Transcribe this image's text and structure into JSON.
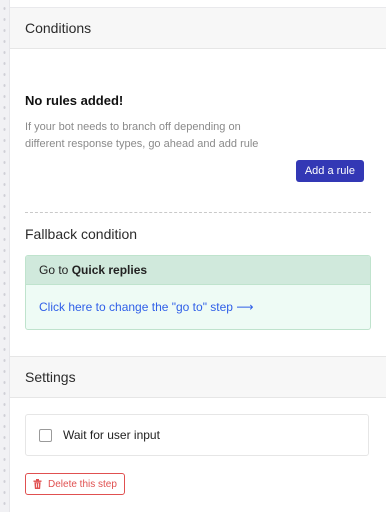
{
  "conditions": {
    "title": "Conditions",
    "empty_title": "No rules added!",
    "empty_description": "If your bot needs to branch off depending on different response types, go ahead and add rule",
    "add_rule_label": "Add a rule"
  },
  "fallback": {
    "title": "Fallback condition",
    "goto_prefix": "Go to",
    "goto_target": "Quick replies",
    "change_link": "Click here to change the \"go to\" step",
    "arrow_glyph": "⟶"
  },
  "settings": {
    "title": "Settings",
    "wait_for_input_label": "Wait for user input",
    "wait_for_input_checked": false
  },
  "delete_label": "Delete this step",
  "icons": {
    "delete": "trash-icon",
    "arrow": "arrow-right-icon"
  },
  "colors": {
    "primary_button": "#3338b5",
    "link": "#2f5fe8",
    "danger": "#e05050",
    "fallback_header_bg": "#d0e9dc",
    "fallback_body_bg": "#eefbf5"
  }
}
